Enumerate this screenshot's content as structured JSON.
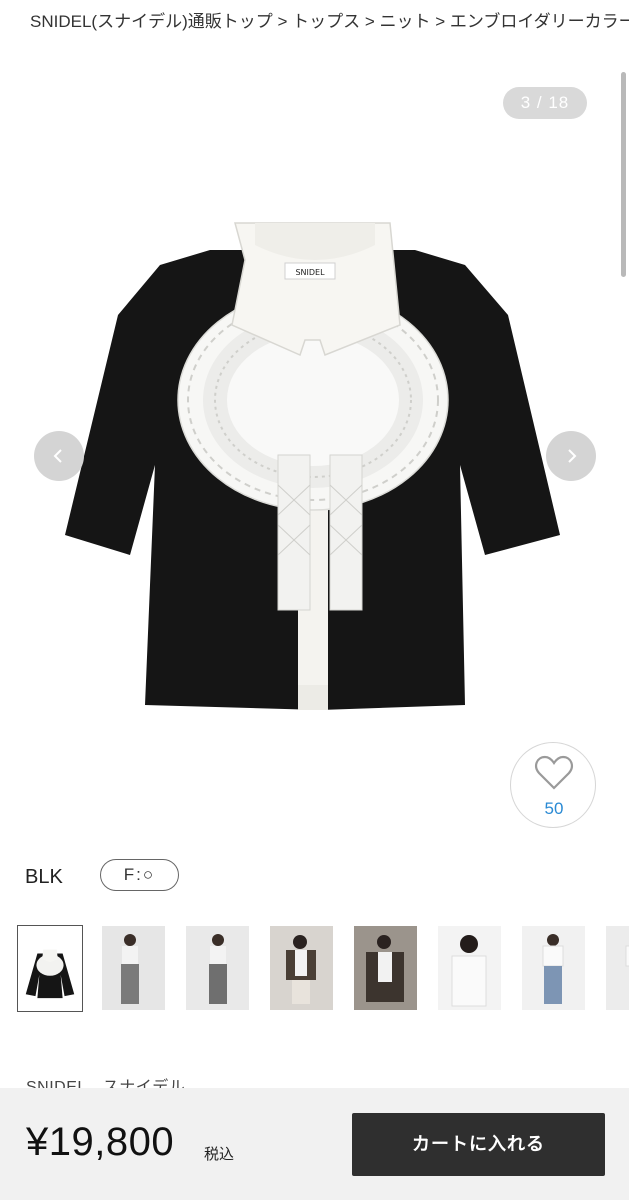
{
  "breadcrumb": {
    "text": "SNIDEL(スナイデル)通販トップ > トップス > ニット > エンブロイダリーカラー"
  },
  "gallery": {
    "counter": "3 / 18",
    "prev_icon": "chevron-left-icon",
    "next_icon": "chevron-right-icon",
    "image_alt": "product-image-knit-top",
    "tag_text": "SNIDEL"
  },
  "favorite": {
    "icon": "heart-outline-icon",
    "count": "50"
  },
  "variant": {
    "color": "BLK",
    "size": "F:○"
  },
  "brand_line": "SNIDEL　スナイデル",
  "purchase": {
    "price": "¥19,800",
    "tax_label": "税込",
    "cart_button": "カートに入れる"
  },
  "colors": {
    "counter_bg": "#d9d9d9",
    "nav_bg": "#d4d4d4",
    "favorite_count": "#2a8ad4",
    "cart_button_bg": "#2f2f2f",
    "bottom_bar_bg": "#f1f1f1"
  }
}
